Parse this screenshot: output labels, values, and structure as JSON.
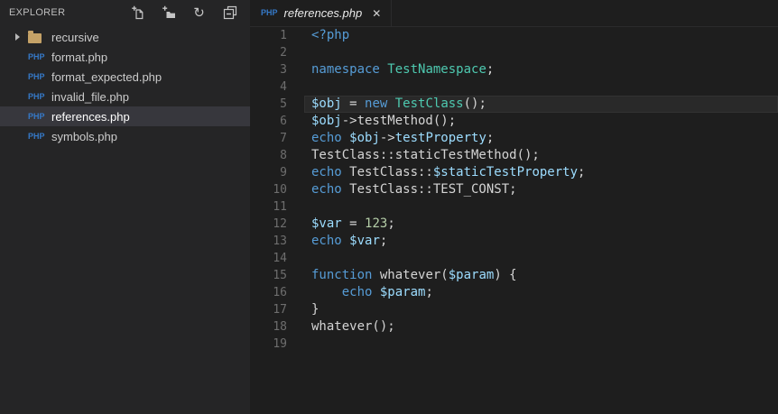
{
  "colors": {
    "bg-editor": "#1e1e1e",
    "bg-sidebar": "#252526",
    "bg-selected": "#37373d",
    "kw": "#569cd6",
    "cls": "#4ec9b0",
    "var": "#9cdcfe",
    "def": "#d4d4d4",
    "num": "#b5cea8",
    "line-number": "#6e6e6e",
    "php-badge": "#3579c8",
    "folder": "#c5a267",
    "ui-text": "#cccccc",
    "icon": "#c5c5c5"
  },
  "sidebar": {
    "title": "EXPLORER",
    "actions": [
      {
        "icon": "new-file-icon"
      },
      {
        "icon": "new-folder-icon"
      },
      {
        "icon": "refresh-icon"
      },
      {
        "icon": "collapse-all-icon"
      }
    ],
    "php_badge": "PHP",
    "items": [
      {
        "kind": "folder",
        "label": "recursive",
        "expanded": false
      },
      {
        "kind": "php",
        "label": "format.php"
      },
      {
        "kind": "php",
        "label": "format_expected.php"
      },
      {
        "kind": "php",
        "label": "invalid_file.php"
      },
      {
        "kind": "php",
        "label": "references.php",
        "selected": true
      },
      {
        "kind": "php",
        "label": "symbols.php"
      }
    ]
  },
  "editor": {
    "tab": {
      "icon": "PHP",
      "label": "references.php",
      "close": "✕"
    },
    "lines": [
      {
        "n": 1,
        "tokens": [
          [
            "kw",
            "<?php"
          ]
        ]
      },
      {
        "n": 2,
        "tokens": []
      },
      {
        "n": 3,
        "tokens": [
          [
            "kw",
            "namespace"
          ],
          [
            "def",
            " "
          ],
          [
            "cls",
            "TestNamespace"
          ],
          [
            "def",
            ";"
          ]
        ]
      },
      {
        "n": 4,
        "tokens": []
      },
      {
        "n": 5,
        "current": true,
        "tokens": [
          [
            "var",
            "$obj"
          ],
          [
            "def",
            " = "
          ],
          [
            "kw",
            "new"
          ],
          [
            "def",
            " "
          ],
          [
            "cls",
            "TestClass"
          ],
          [
            "def",
            "();"
          ]
        ]
      },
      {
        "n": 6,
        "tokens": [
          [
            "var",
            "$obj"
          ],
          [
            "def",
            "->testMethod();"
          ]
        ]
      },
      {
        "n": 7,
        "tokens": [
          [
            "kw",
            "echo"
          ],
          [
            "def",
            " "
          ],
          [
            "var",
            "$obj"
          ],
          [
            "def",
            "->"
          ],
          [
            "var",
            "testProperty"
          ],
          [
            "def",
            ";"
          ]
        ]
      },
      {
        "n": 8,
        "tokens": [
          [
            "def",
            "TestClass::staticTestMethod();"
          ]
        ]
      },
      {
        "n": 9,
        "tokens": [
          [
            "kw",
            "echo"
          ],
          [
            "def",
            " TestClass::"
          ],
          [
            "var",
            "$staticTestProperty"
          ],
          [
            "def",
            ";"
          ]
        ]
      },
      {
        "n": 10,
        "tokens": [
          [
            "kw",
            "echo"
          ],
          [
            "def",
            " TestClass::TEST_CONST;"
          ]
        ]
      },
      {
        "n": 11,
        "tokens": []
      },
      {
        "n": 12,
        "tokens": [
          [
            "var",
            "$var"
          ],
          [
            "def",
            " = "
          ],
          [
            "num",
            "123"
          ],
          [
            "def",
            ";"
          ]
        ]
      },
      {
        "n": 13,
        "tokens": [
          [
            "kw",
            "echo"
          ],
          [
            "def",
            " "
          ],
          [
            "var",
            "$var"
          ],
          [
            "def",
            ";"
          ]
        ]
      },
      {
        "n": 14,
        "tokens": []
      },
      {
        "n": 15,
        "tokens": [
          [
            "kw",
            "function"
          ],
          [
            "def",
            " whatever("
          ],
          [
            "var",
            "$param"
          ],
          [
            "def",
            ") {"
          ]
        ]
      },
      {
        "n": 16,
        "tokens": [
          [
            "def",
            "    "
          ],
          [
            "kw",
            "echo"
          ],
          [
            "def",
            " "
          ],
          [
            "var",
            "$param"
          ],
          [
            "def",
            ";"
          ]
        ]
      },
      {
        "n": 17,
        "tokens": [
          [
            "def",
            "}"
          ]
        ]
      },
      {
        "n": 18,
        "tokens": [
          [
            "def",
            "whatever();"
          ]
        ]
      },
      {
        "n": 19,
        "tokens": []
      }
    ]
  }
}
